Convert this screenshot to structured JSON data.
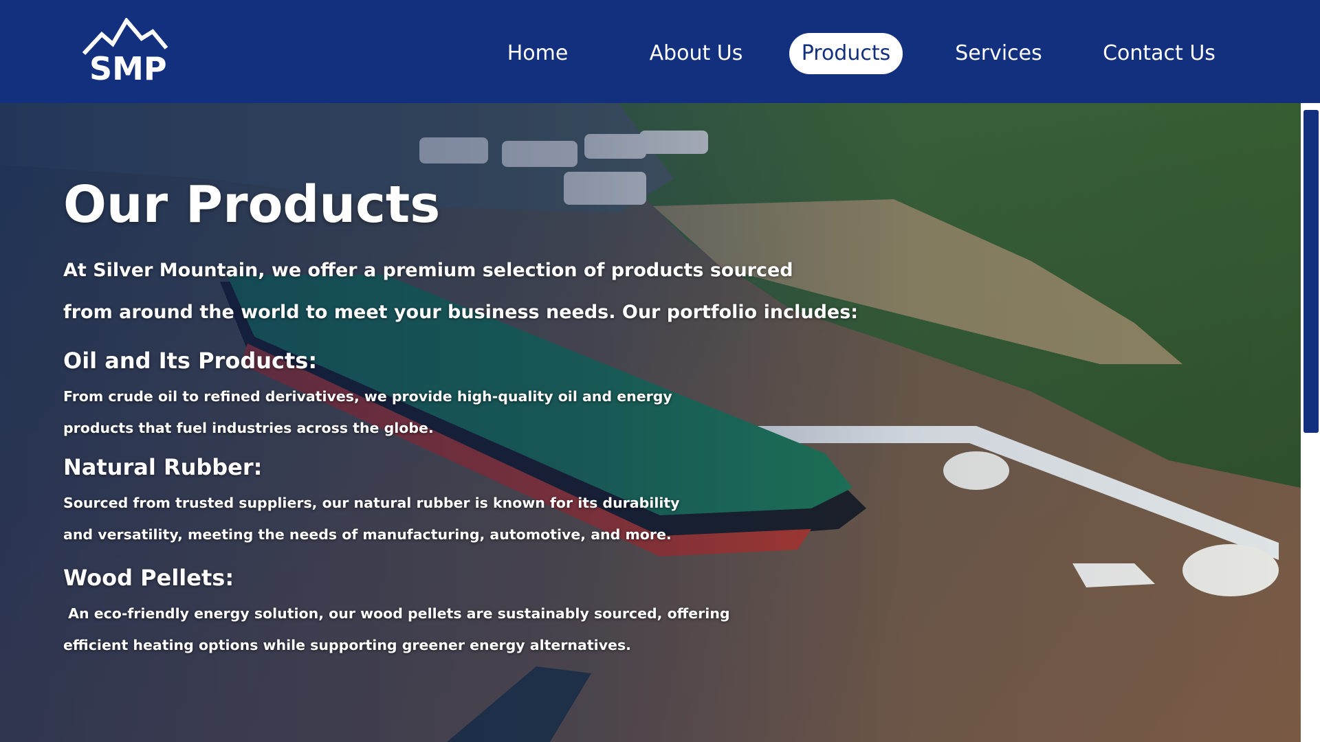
{
  "brand": {
    "logo_text": "SMP"
  },
  "nav": {
    "items": [
      {
        "label": "Home"
      },
      {
        "label": "About Us"
      },
      {
        "label": "Products"
      },
      {
        "label": "Services"
      },
      {
        "label": "Contact Us"
      }
    ],
    "active": "Products"
  },
  "colors": {
    "header_bg": "#13307f",
    "active_pill_bg": "#ffffff",
    "active_pill_text": "#13307f",
    "text": "#ffffff"
  },
  "main": {
    "title": "Our Products",
    "intro_lines": [
      "At Silver Mountain, we offer a premium selection of products sourced",
      "from around the world to meet your business needs. Our portfolio includes:"
    ],
    "sections": [
      {
        "heading": "Oil and Its Products:",
        "lines": [
          "From crude oil to refined derivatives, we provide high-quality oil and energy",
          "products that fuel industries across the globe."
        ]
      },
      {
        "heading": "Natural Rubber:",
        "lines": [
          "Sourced from trusted suppliers, our natural rubber is known for its durability",
          "and versatility, meeting the needs of manufacturing, automotive, and more."
        ]
      },
      {
        "heading": "Wood Pellets:",
        "lines": [
          " An eco-friendly energy solution, our wood pellets are sustainably sourced, offering",
          "efficient heating options while supporting greener energy alternatives."
        ]
      }
    ]
  },
  "hero_image": {
    "description_icon": "oil-tanker-port-photo"
  }
}
